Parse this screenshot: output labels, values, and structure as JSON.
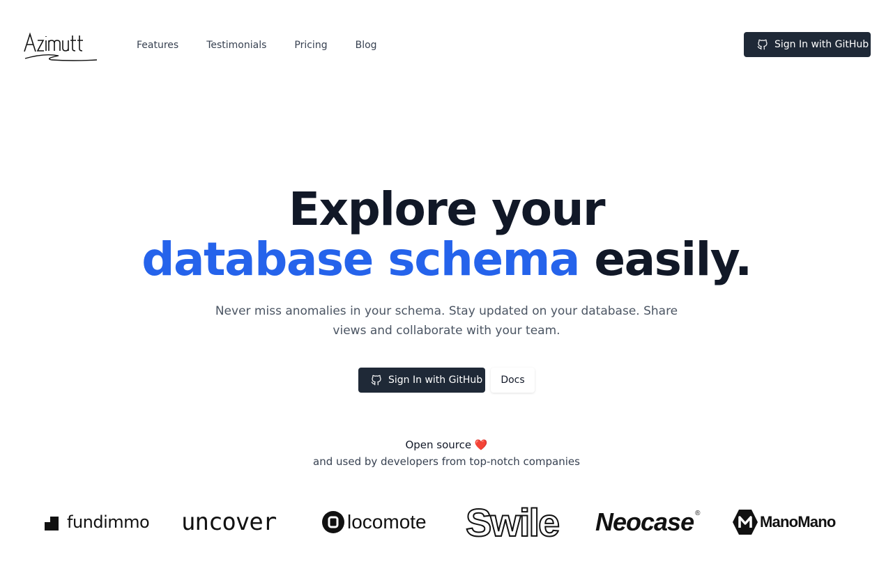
{
  "header": {
    "logo_text": "Azimutt",
    "nav": [
      "Features",
      "Testimonials",
      "Pricing",
      "Blog"
    ],
    "signin_label": "Sign In with GitHub"
  },
  "hero": {
    "title_line1": "Explore your",
    "title_accent": "database schema",
    "title_rest": "easily.",
    "subtitle": "Never miss anomalies in your schema. Stay updated on your database. Share views and collaborate with your team.",
    "cta_primary": "Sign In with GitHub",
    "cta_secondary": "Docs"
  },
  "social_proof": {
    "line1": "Open source",
    "heart": "❤️",
    "line2": "and used by developers from top-notch companies",
    "companies": [
      "fundimmo",
      "uncover",
      "locomote",
      "Swile",
      "Neocase",
      "ManoMano"
    ],
    "neocase_mark": "®"
  },
  "colors": {
    "accent": "#2563eb",
    "dark_button": "#1f2937",
    "heading": "#111827"
  }
}
